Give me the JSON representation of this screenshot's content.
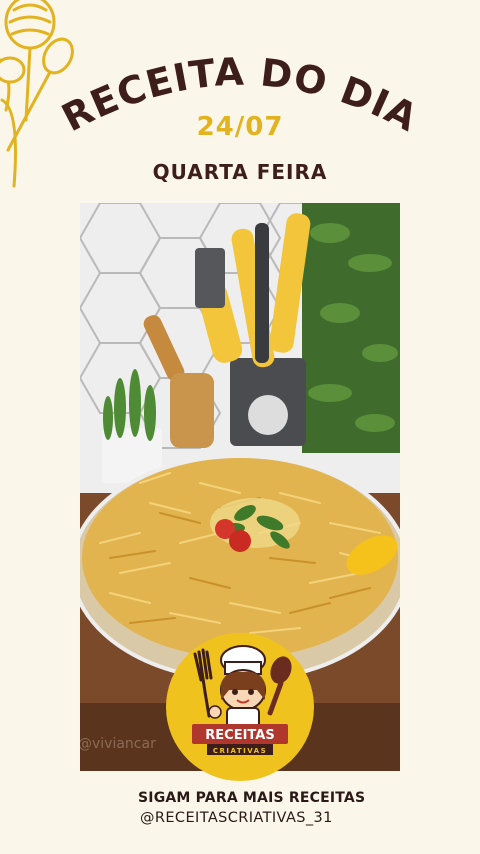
{
  "header": {
    "title": "RECEITA DO DIA",
    "date": "24/07",
    "weekday": "QUARTA FEIRA"
  },
  "photo": {
    "watermark": "@viviancar"
  },
  "badge": {
    "line1": "RECEITAS",
    "line2": "CRIATIVAS"
  },
  "footer": {
    "follow": "SIGAM PARA MAIS RECEITAS",
    "handle": "@RECEITASCRIATIVAS_31"
  },
  "colors": {
    "background": "#fbf6ea",
    "title": "#3d1e1a",
    "accent": "#e2b21f"
  },
  "icons": [
    "whisk-icon",
    "spoon-icon",
    "chef-mascot-icon",
    "fork-icon"
  ]
}
